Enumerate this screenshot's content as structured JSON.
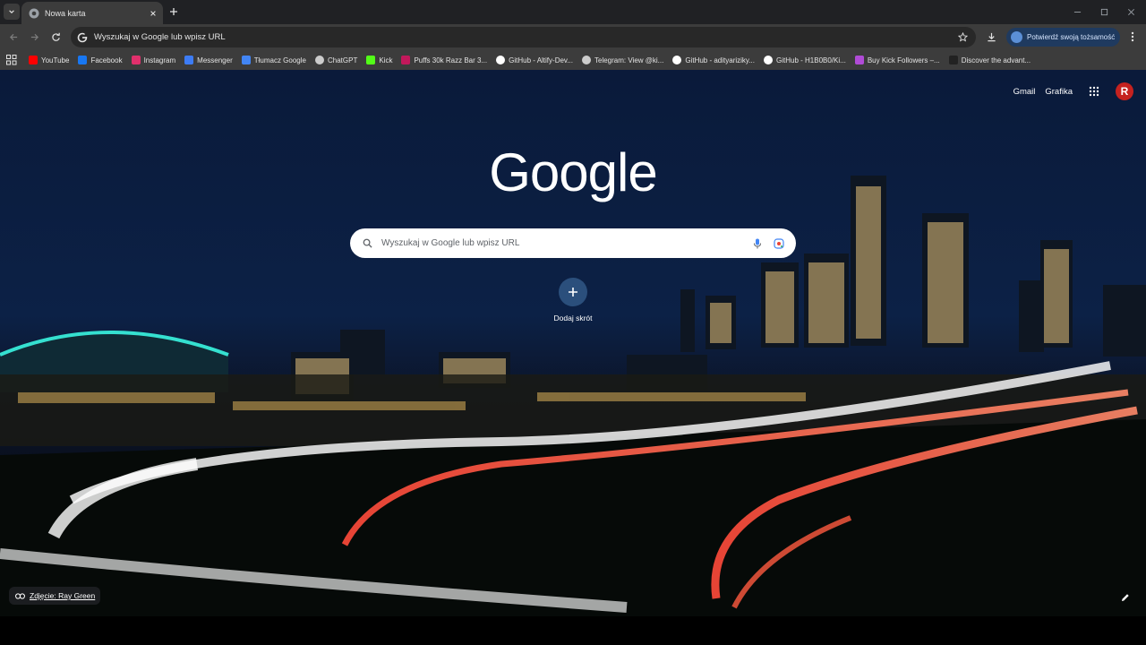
{
  "tab": {
    "title": "Nowa karta"
  },
  "omnibox": {
    "text": "Wyszukaj w Google lub wpisz URL"
  },
  "verify_identity": {
    "label": "Potwierdź swoją tożsamość"
  },
  "bookmarks": [
    {
      "label": "YouTube",
      "icon": "youtube-icon",
      "color": "#ff0000"
    },
    {
      "label": "Facebook",
      "icon": "facebook-icon",
      "color": "#1877f2"
    },
    {
      "label": "Instagram",
      "icon": "instagram-icon",
      "color": "#e1306c"
    },
    {
      "label": "Messenger",
      "icon": "messenger-icon",
      "color": "#3d7cf5"
    },
    {
      "label": "Tłumacz Google",
      "icon": "translate-icon",
      "color": "#4285f4"
    },
    {
      "label": "ChatGPT",
      "icon": "chatgpt-icon",
      "color": "#cccccc"
    },
    {
      "label": "Kick",
      "icon": "kick-icon",
      "color": "#53fc18"
    },
    {
      "label": "Puffs 30k Razz Bar 3...",
      "icon": "puffs-icon",
      "color": "#c2185b"
    },
    {
      "label": "GitHub - Altify-Dev...",
      "icon": "github-icon",
      "color": "#ffffff"
    },
    {
      "label": "Telegram: View @ki...",
      "icon": "telegram-icon",
      "color": "#cccccc"
    },
    {
      "label": "GitHub - adityariziky...",
      "icon": "github-icon",
      "color": "#ffffff"
    },
    {
      "label": "GitHub - H1B0B0/Ki...",
      "icon": "github-icon",
      "color": "#ffffff"
    },
    {
      "label": "Buy Kick Followers –...",
      "icon": "kick-followers-icon",
      "color": "#b04bd6"
    },
    {
      "label": "Discover the advant...",
      "icon": "discover-icon",
      "color": "#222222"
    }
  ],
  "top_links": {
    "gmail": "Gmail",
    "images": "Grafika",
    "avatar_letter": "R"
  },
  "logo": "Google",
  "search": {
    "placeholder": "Wyszukaj w Google lub wpisz URL"
  },
  "shortcut": {
    "label": "Dodaj skrót"
  },
  "credit": {
    "label": "Zdjęcie: Ray Green"
  },
  "colors": {
    "accent": "#1f3a5f",
    "avatar": "#c5221f"
  }
}
